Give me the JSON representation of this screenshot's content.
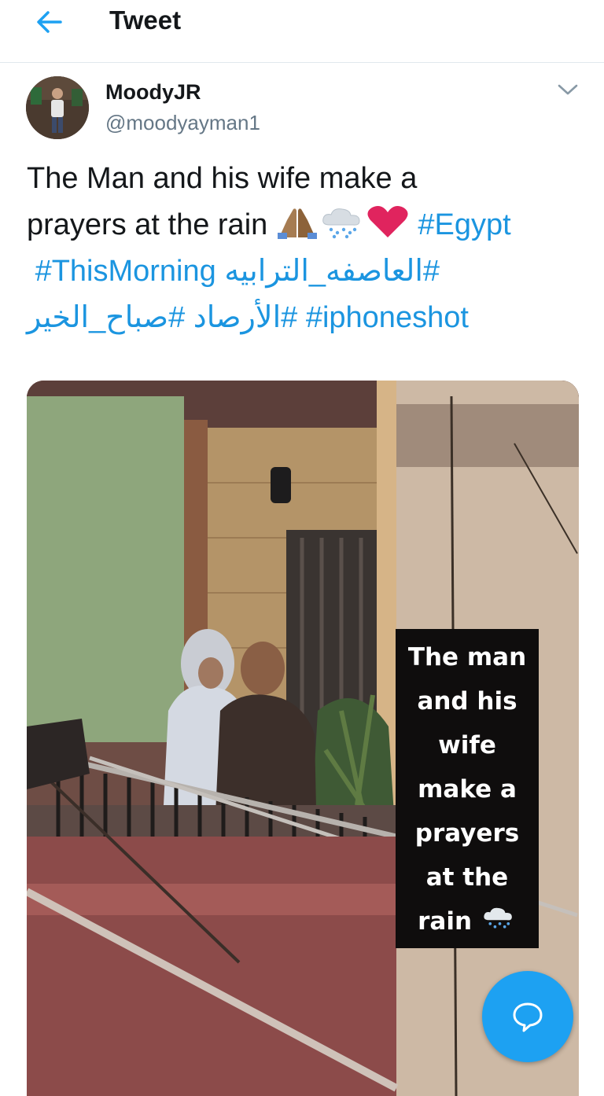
{
  "header": {
    "title": "Tweet",
    "back_icon": "arrow-left-icon"
  },
  "tweet": {
    "author": {
      "name": "MoodyJR",
      "handle": "@moodyayman1"
    },
    "text": {
      "line1": "The Man and his wife make a",
      "line2_text": "prayers at the rain",
      "emojis": [
        "folded-hands-icon",
        "rain-cloud-icon",
        "red-heart-icon"
      ],
      "hashtags": {
        "egypt": "#Egypt",
        "this_morning": "#ThisMorning",
        "storm_ar": "#العاصفه_الترابيه",
        "morning_ar": "#صباح_الخير",
        "iphoneshot": "#iphoneshot",
        "irsad_ar": "#الأرصاد"
      }
    },
    "media": {
      "overlay_caption": [
        "The man",
        "and his",
        "wife",
        "make a",
        "prayers",
        "at the",
        "rain"
      ],
      "overlay_icon": "rain-cloud-icon"
    }
  },
  "compose_button": {
    "icon": "speech-bubble-icon"
  },
  "colors": {
    "accent": "#1da1f2",
    "link": "#1b95e0",
    "text": "#14171a",
    "secondary": "#657786",
    "heart": "#e0245e"
  }
}
